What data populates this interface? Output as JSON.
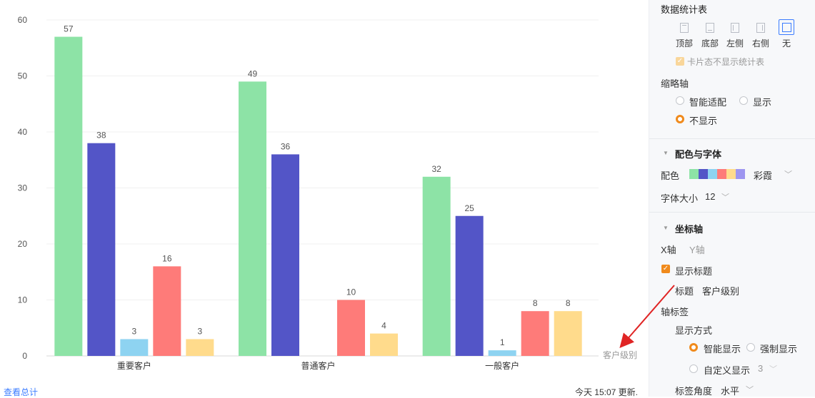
{
  "chart_data": {
    "type": "bar",
    "categories": [
      "重要客户",
      "普通客户",
      "一般客户"
    ],
    "series": [
      {
        "color": "#8de3a6",
        "values": [
          57,
          49,
          32
        ]
      },
      {
        "color": "#5355c7",
        "values": [
          38,
          36,
          25
        ]
      },
      {
        "color": "#8ed3f1",
        "values": [
          3,
          null,
          1
        ]
      },
      {
        "color": "#fe7b79",
        "values": [
          16,
          10,
          8
        ]
      },
      {
        "color": "#ffdb8c",
        "values": [
          3,
          4,
          8
        ]
      }
    ],
    "ylim": [
      0,
      60
    ],
    "yticks": [
      "0",
      "10",
      "20",
      "30",
      "40",
      "50",
      "60"
    ],
    "xlabel": "客户级别",
    "ylabel": "",
    "title": "",
    "grid": true
  },
  "footer": {
    "link": "查看总计",
    "updated": "今天 15:07 更新."
  },
  "panel": {
    "legend_section": {
      "title": "数据统计表",
      "options": [
        "顶部",
        "底部",
        "左侧",
        "右侧",
        "无"
      ],
      "selected": "无",
      "card_hide": "卡片态不显示统计表"
    },
    "thumb_axis": {
      "title": "缩略轴",
      "options": [
        "智能适配",
        "显示",
        "不显示"
      ],
      "selected": "不显示"
    },
    "color_font": {
      "title": "配色与字体",
      "color_label": "配色",
      "palette_name": "彩霞",
      "palette": [
        "#8de3a6",
        "#5355c7",
        "#8ed3f1",
        "#fe7b79",
        "#ffdb8c",
        "#9e96f0"
      ],
      "font_size_label": "字体大小",
      "font_size": "12"
    },
    "axis": {
      "title": "坐标轴",
      "tab_x": "X轴",
      "tab_y": "Y轴",
      "show_title": "显示标题",
      "title_label": "标题",
      "title_value": "客户级别",
      "tick_label": "轴标签",
      "display_mode": "显示方式",
      "smart": "智能显示",
      "force": "强制显示",
      "custom": "自定义显示",
      "custom_value": "3",
      "angle_label": "标签角度",
      "angle_value": "水平"
    },
    "accent": "#f08a1c",
    "selected_blue": "#3b7cff"
  }
}
